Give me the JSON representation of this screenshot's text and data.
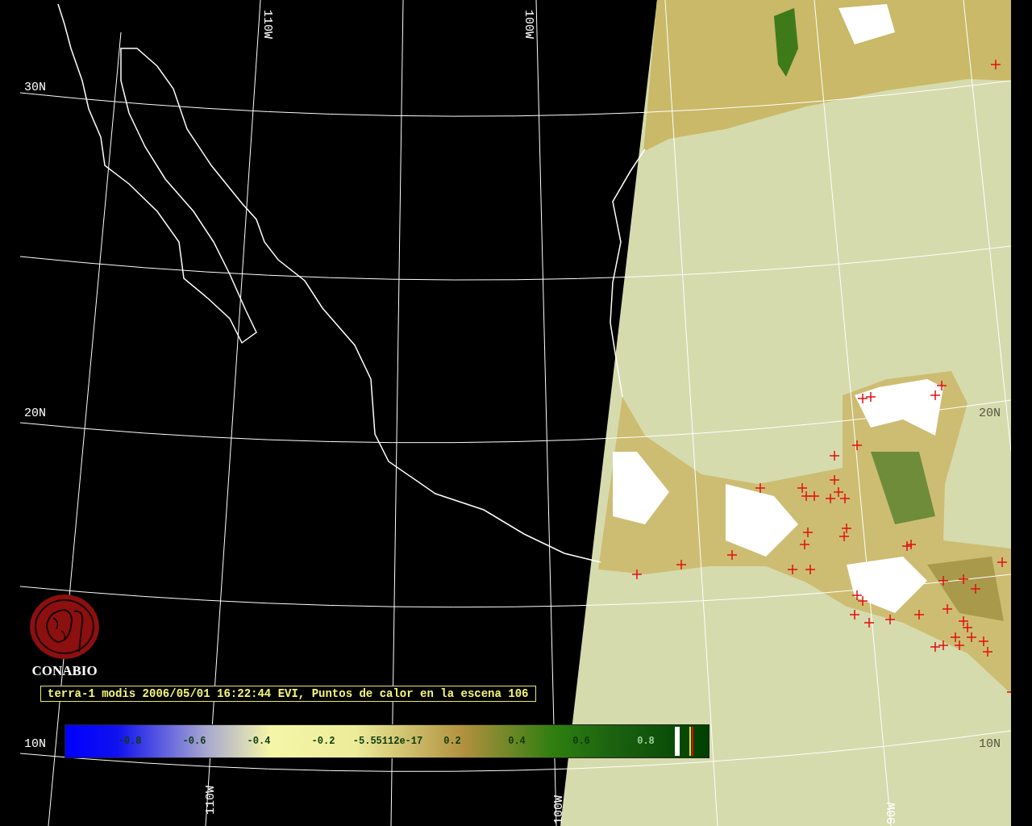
{
  "latitude_labels": [
    "30N",
    "20N",
    "20N",
    "10N",
    "10N"
  ],
  "longitude_labels": [
    "110W",
    "100W",
    "110W",
    "100W",
    "90W"
  ],
  "logo": {
    "name": "CONABIO"
  },
  "caption": "terra-1 modis 2006/05/01 16:22:44 EVI, Puntos de calor en la escena 106",
  "colorbar": {
    "tick_labels": [
      "-0.8",
      "-0.6",
      "-0.4",
      "-0.2",
      "-5.55112e-17",
      "0.2",
      "0.4",
      "0.6",
      "0.8"
    ]
  }
}
